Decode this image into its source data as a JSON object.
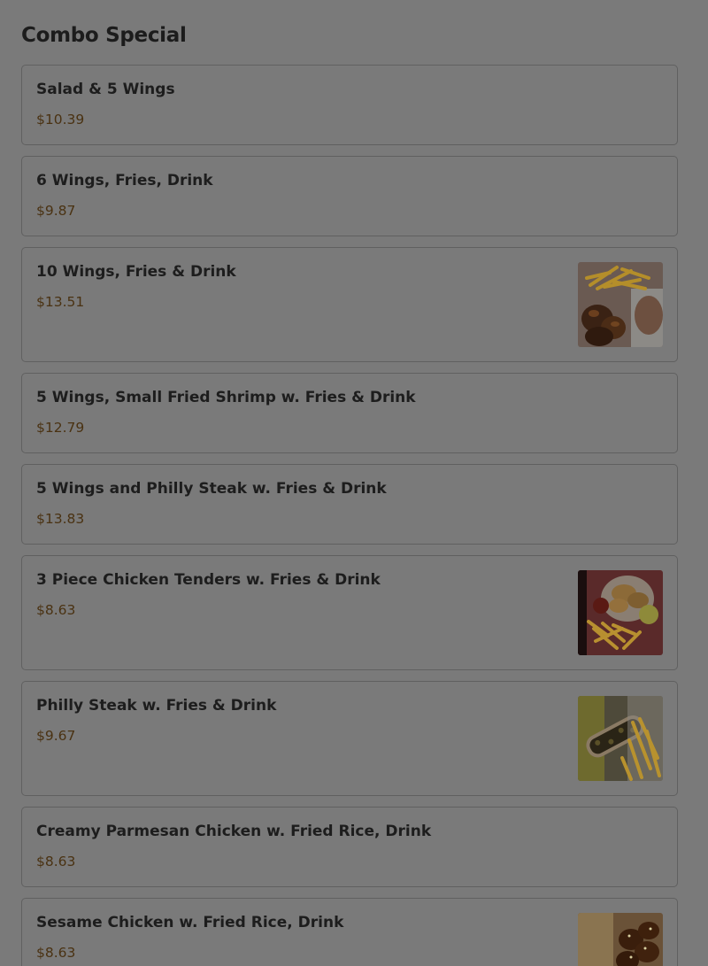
{
  "section": {
    "title": "Combo Special"
  },
  "items": [
    {
      "name": "Salad & 5 Wings",
      "price": "$10.39"
    },
    {
      "name": "6 Wings, Fries, Drink",
      "price": "$9.87"
    },
    {
      "name": "10 Wings, Fries & Drink",
      "price": "$13.51",
      "image": "wings-and-fries-photo"
    },
    {
      "name": "5 Wings, Small Fried Shrimp w. Fries & Drink",
      "price": "$12.79"
    },
    {
      "name": "5 Wings and Philly Steak w. Fries & Drink",
      "price": "$13.83"
    },
    {
      "name": "3 Piece Chicken Tenders w. Fries & Drink",
      "price": "$8.63",
      "image": "chicken-tenders-photo"
    },
    {
      "name": "Philly Steak w. Fries & Drink",
      "price": "$9.67",
      "image": "philly-steak-photo"
    },
    {
      "name": "Creamy Parmesan Chicken w. Fried Rice, Drink",
      "price": "$8.63"
    },
    {
      "name": "Sesame Chicken w. Fried Rice, Drink",
      "price": "$8.63",
      "image": "sesame-chicken-photo"
    }
  ]
}
